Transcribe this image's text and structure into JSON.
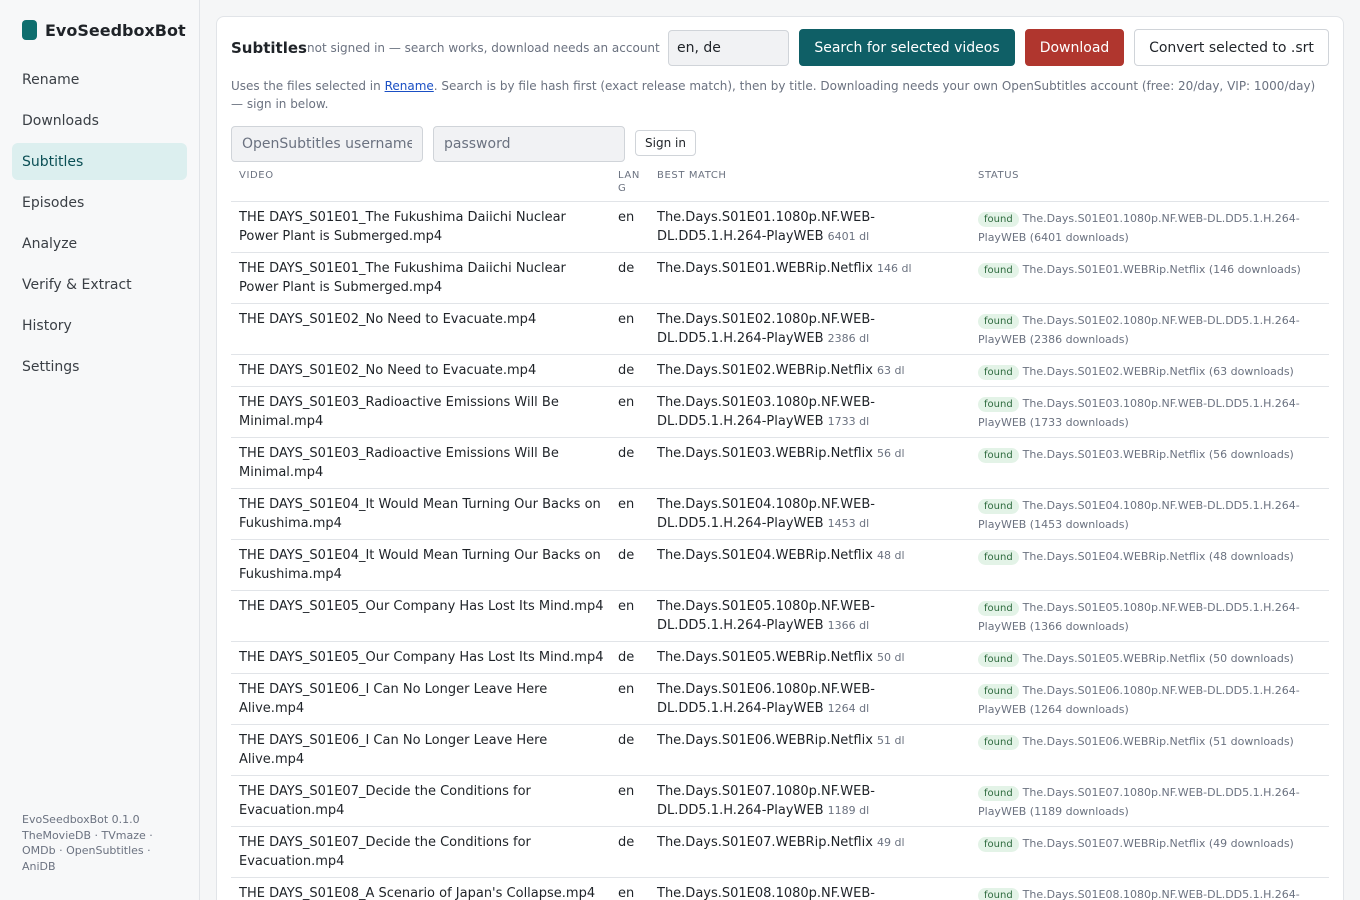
{
  "app": {
    "name": "EvoSeedboxBot"
  },
  "sidebar": {
    "items": [
      {
        "label": "Rename",
        "active": false
      },
      {
        "label": "Downloads",
        "active": false
      },
      {
        "label": "Subtitles",
        "active": true
      },
      {
        "label": "Episodes",
        "active": false
      },
      {
        "label": "Analyze",
        "active": false
      },
      {
        "label": "Verify & Extract",
        "active": false
      },
      {
        "label": "History",
        "active": false
      },
      {
        "label": "Settings",
        "active": false
      }
    ],
    "footer": "EvoSeedboxBot 0.1.0 TheMovieDB · TVmaze · OMDb · OpenSubtitles · AniDB"
  },
  "header": {
    "title": "Subtitles",
    "subtitle": "not signed in — search works, download needs an account",
    "languages_value": "en, de",
    "search_label": "Search for selected videos",
    "download_label": "Download",
    "convert_label": "Convert selected to .srt"
  },
  "info": {
    "before_link": "Uses the files selected in ",
    "link": "Rename",
    "after_link": ". Search is by file hash first (exact release match), then by title. Downloading needs your own OpenSubtitles account (free: 20/day, VIP: 1000/day) — sign in below."
  },
  "auth": {
    "username_placeholder": "OpenSubtitles username",
    "password_placeholder": "password",
    "signin_label": "Sign in"
  },
  "table": {
    "headers": {
      "video": "VIDEO",
      "lang": "LANG",
      "match": "BEST MATCH",
      "status": "STATUS"
    },
    "rows": [
      {
        "video": "THE DAYS_S01E01_The Fukushima Daiichi Nuclear Power Plant is Submerged.mp4",
        "lang": "en",
        "match": "The.Days.S01E01.1080p.NF.WEB-DL.DD5.1.H.264-PlayWEB",
        "dl": "6401 dl",
        "badge": "found",
        "status": "The.Days.S01E01.1080p.NF.WEB-DL.DD5.1.H.264-PlayWEB (6401 downloads)"
      },
      {
        "video": "THE DAYS_S01E01_The Fukushima Daiichi Nuclear Power Plant is Submerged.mp4",
        "lang": "de",
        "match": "The.Days.S01E01.WEBRip.Netflix",
        "dl": "146 dl",
        "badge": "found",
        "status": "The.Days.S01E01.WEBRip.Netflix (146 downloads)"
      },
      {
        "video": "THE DAYS_S01E02_No Need to Evacuate.mp4",
        "lang": "en",
        "match": "The.Days.S01E02.1080p.NF.WEB-DL.DD5.1.H.264-PlayWEB",
        "dl": "2386 dl",
        "badge": "found",
        "status": "The.Days.S01E02.1080p.NF.WEB-DL.DD5.1.H.264-PlayWEB (2386 downloads)"
      },
      {
        "video": "THE DAYS_S01E02_No Need to Evacuate.mp4",
        "lang": "de",
        "match": "The.Days.S01E02.WEBRip.Netflix",
        "dl": "63 dl",
        "badge": "found",
        "status": "The.Days.S01E02.WEBRip.Netflix (63 downloads)"
      },
      {
        "video": "THE DAYS_S01E03_Radioactive Emissions Will Be Minimal.mp4",
        "lang": "en",
        "match": "The.Days.S01E03.1080p.NF.WEB-DL.DD5.1.H.264-PlayWEB",
        "dl": "1733 dl",
        "badge": "found",
        "status": "The.Days.S01E03.1080p.NF.WEB-DL.DD5.1.H.264-PlayWEB (1733 downloads)"
      },
      {
        "video": "THE DAYS_S01E03_Radioactive Emissions Will Be Minimal.mp4",
        "lang": "de",
        "match": "The.Days.S01E03.WEBRip.Netflix",
        "dl": "56 dl",
        "badge": "found",
        "status": "The.Days.S01E03.WEBRip.Netflix (56 downloads)"
      },
      {
        "video": "THE DAYS_S01E04_It Would Mean Turning Our Backs on Fukushima.mp4",
        "lang": "en",
        "match": "The.Days.S01E04.1080p.NF.WEB-DL.DD5.1.H.264-PlayWEB",
        "dl": "1453 dl",
        "badge": "found",
        "status": "The.Days.S01E04.1080p.NF.WEB-DL.DD5.1.H.264-PlayWEB (1453 downloads)"
      },
      {
        "video": "THE DAYS_S01E04_It Would Mean Turning Our Backs on Fukushima.mp4",
        "lang": "de",
        "match": "The.Days.S01E04.WEBRip.Netflix",
        "dl": "48 dl",
        "badge": "found",
        "status": "The.Days.S01E04.WEBRip.Netflix (48 downloads)"
      },
      {
        "video": "THE DAYS_S01E05_Our Company Has Lost Its Mind.mp4",
        "lang": "en",
        "match": "The.Days.S01E05.1080p.NF.WEB-DL.DD5.1.H.264-PlayWEB",
        "dl": "1366 dl",
        "badge": "found",
        "status": "The.Days.S01E05.1080p.NF.WEB-DL.DD5.1.H.264-PlayWEB (1366 downloads)"
      },
      {
        "video": "THE DAYS_S01E05_Our Company Has Lost Its Mind.mp4",
        "lang": "de",
        "match": "The.Days.S01E05.WEBRip.Netflix",
        "dl": "50 dl",
        "badge": "found",
        "status": "The.Days.S01E05.WEBRip.Netflix (50 downloads)"
      },
      {
        "video": "THE DAYS_S01E06_I Can No Longer Leave Here Alive.mp4",
        "lang": "en",
        "match": "The.Days.S01E06.1080p.NF.WEB-DL.DD5.1.H.264-PlayWEB",
        "dl": "1264 dl",
        "badge": "found",
        "status": "The.Days.S01E06.1080p.NF.WEB-DL.DD5.1.H.264-PlayWEB (1264 downloads)"
      },
      {
        "video": "THE DAYS_S01E06_I Can No Longer Leave Here Alive.mp4",
        "lang": "de",
        "match": "The.Days.S01E06.WEBRip.Netflix",
        "dl": "51 dl",
        "badge": "found",
        "status": "The.Days.S01E06.WEBRip.Netflix (51 downloads)"
      },
      {
        "video": "THE DAYS_S01E07_Decide the Conditions for Evacuation.mp4",
        "lang": "en",
        "match": "The.Days.S01E07.1080p.NF.WEB-DL.DD5.1.H.264-PlayWEB",
        "dl": "1189 dl",
        "badge": "found",
        "status": "The.Days.S01E07.1080p.NF.WEB-DL.DD5.1.H.264-PlayWEB (1189 downloads)"
      },
      {
        "video": "THE DAYS_S01E07_Decide the Conditions for Evacuation.mp4",
        "lang": "de",
        "match": "The.Days.S01E07.WEBRip.Netflix",
        "dl": "49 dl",
        "badge": "found",
        "status": "The.Days.S01E07.WEBRip.Netflix (49 downloads)"
      },
      {
        "video": "THE DAYS_S01E08_A Scenario of Japan's Collapse.mp4",
        "lang": "en",
        "match": "The.Days.S01E08.1080p.NF.WEB-",
        "dl": "",
        "badge": "found",
        "status": "The.Days.S01E08.1080p.NF.WEB-DL.DD5.1.H.264-"
      }
    ]
  }
}
